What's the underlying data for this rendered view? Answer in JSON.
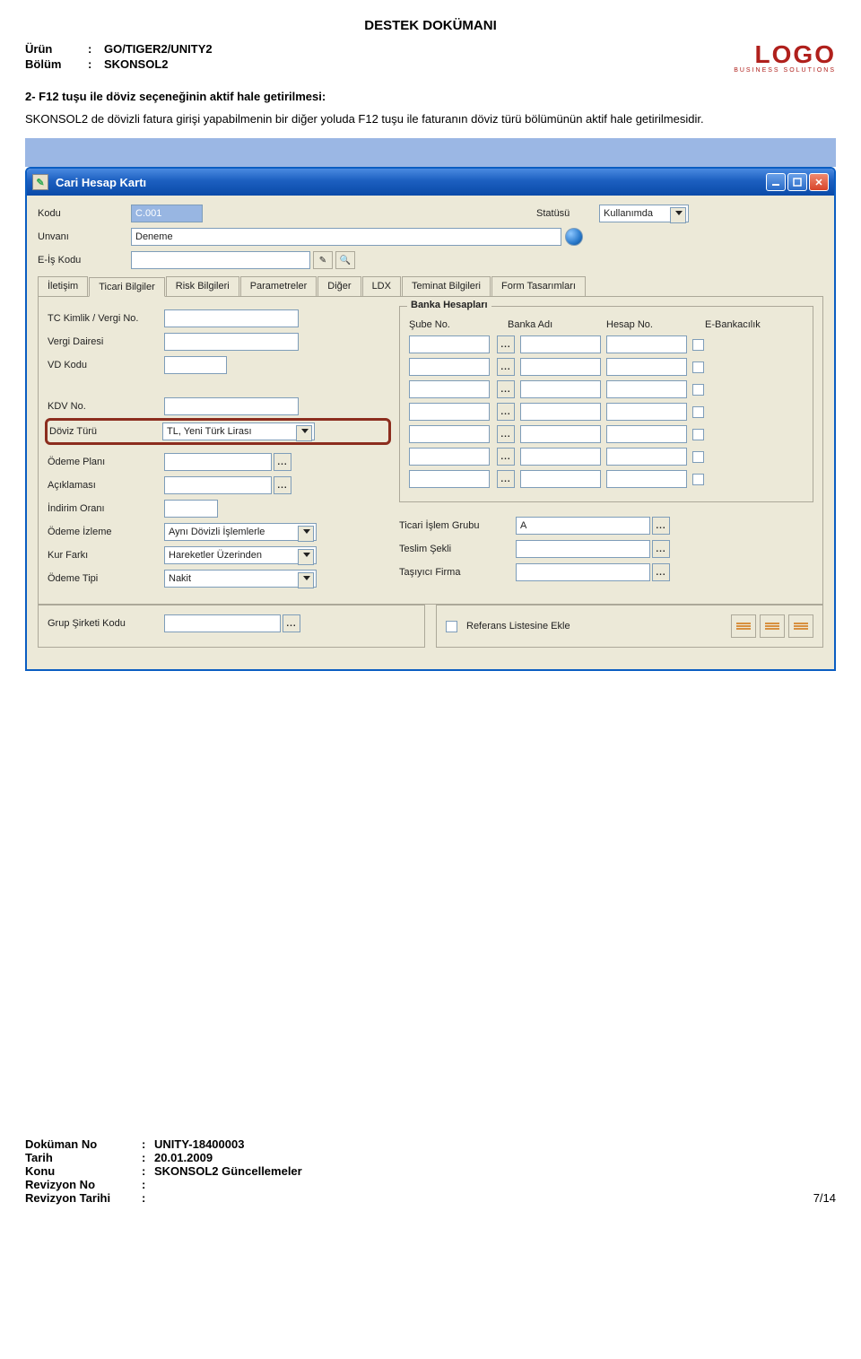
{
  "doc": {
    "title": "DESTEK DOKÜMANI",
    "urun_label": "Ürün",
    "urun_value": "GO/TIGER2/UNITY2",
    "bolum_label": "Bölüm",
    "bolum_value": "SKONSOL2",
    "logo_text": "LOGO",
    "logo_sub": "BUSINESS SOLUTIONS",
    "section_title": "2- F12 tuşu ile döviz seçeneğinin aktif hale getirilmesi:",
    "body": "SKONSOL2 de dövizli fatura girişi yapabilmenin bir diğer yoluda F12 tuşu ile faturanın döviz türü bölümünün aktif hale getirilmesidir.",
    "colon": ":"
  },
  "window": {
    "title": "Cari Hesap Kartı",
    "labels": {
      "kodu": "Kodu",
      "unvani": "Unvanı",
      "eis": "E-İş Kodu",
      "statusu": "Statüsü"
    },
    "values": {
      "kodu": "C.001",
      "unvani": "Deneme",
      "eis": "",
      "statusu": "Kullanımda"
    },
    "tabs": [
      "İletişim",
      "Ticari Bilgiler",
      "Risk Bilgileri",
      "Parametreler",
      "Diğer",
      "LDX",
      "Teminat Bilgileri",
      "Form Tasarımları"
    ],
    "left": {
      "tc": "TC Kimlik / Vergi No.",
      "vdairesi": "Vergi Dairesi",
      "vdkodu": "VD Kodu",
      "kdvno": "KDV No.",
      "doviz": "Döviz Türü",
      "doviz_val": "TL, Yeni Türk Lirası",
      "odemeplani": "Ödeme Planı",
      "aciklamasi": "Açıklaması",
      "indirim": "İndirim Oranı",
      "odemeizleme": "Ödeme İzleme",
      "odemeizleme_val": "Aynı Dövizli İşlemlerle",
      "kurfarki": "Kur Farkı",
      "kurfarki_val": "Hareketler Üzerinden",
      "odemetipi": "Ödeme Tipi",
      "odemetipi_val": "Nakit"
    },
    "right": {
      "banka_title": "Banka Hesapları",
      "sube": "Şube No.",
      "banka": "Banka Adı",
      "hesap": "Hesap No.",
      "ebank": "E-Bankacılık",
      "ticariislem": "Ticari İşlem Grubu",
      "ticariislem_val": "A",
      "teslim": "Teslim Şekli",
      "tasiyici": "Taşıyıcı Firma"
    },
    "lower": {
      "grup": "Grup Şirketi Kodu",
      "referans": "Referans Listesine Ekle"
    }
  },
  "footer": {
    "dokno_label": "Doküman No",
    "dokno_value": "UNITY-18400003",
    "tarih_label": "Tarih",
    "tarih_value": "20.01.2009",
    "konu_label": "Konu",
    "konu_value": "SKONSOL2 Güncellemeler",
    "revno_label": "Revizyon No",
    "revtarih_label": "Revizyon Tarihi",
    "page": "7/14",
    "colon": ":"
  }
}
